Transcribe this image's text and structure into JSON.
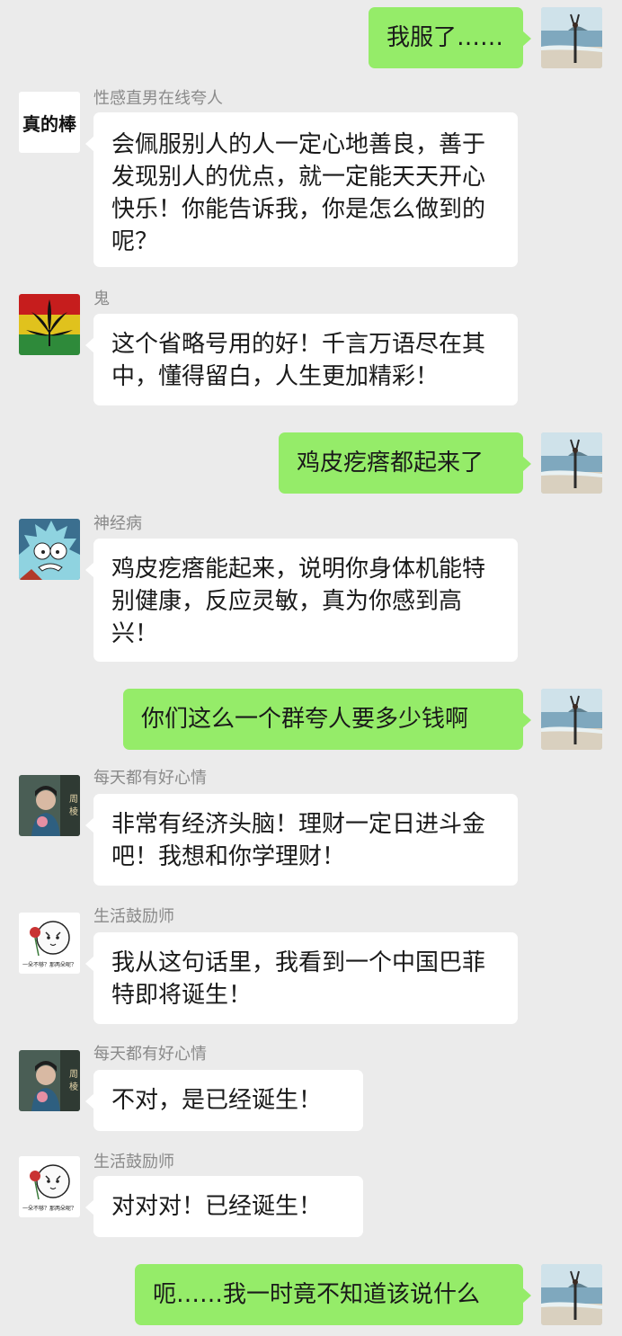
{
  "me": {
    "avatar_icon": "beach-photo-avatar"
  },
  "messages": [
    {
      "side": "right",
      "text": "我服了……"
    },
    {
      "side": "left",
      "name": "性感直男在线夸人",
      "avatar_text": "真的棒",
      "text": "会佩服别人的人一定心地善良，善于发现别人的优点，就一定能天天开心快乐！你能告诉我，你是怎么做到的呢？"
    },
    {
      "side": "left",
      "name": "鬼",
      "avatar_icon": "leaf-avatar",
      "text": "这个省略号用的好！千言万语尽在其中，懂得留白，人生更加精彩！"
    },
    {
      "side": "right",
      "text": "鸡皮疙瘩都起来了"
    },
    {
      "side": "left",
      "name": "神经病",
      "avatar_icon": "cartoon-face-avatar",
      "text": "鸡皮疙瘩能起来，说明你身体机能特别健康，反应灵敏，真为你感到高兴！"
    },
    {
      "side": "right",
      "text": "你们这么一个群夸人要多少钱啊"
    },
    {
      "side": "left",
      "name": "每天都有好心情",
      "avatar_icon": "person-photo-avatar",
      "text": "非常有经济头脑！理财一定日进斗金吧！我想和你学理财！"
    },
    {
      "side": "left",
      "name": "生活鼓励师",
      "avatar_icon": "sticker-face-avatar",
      "avatar_caption": "一朵不够？那两朵呢？",
      "text": "我从这句话里，我看到一个中国巴菲特即将诞生！"
    },
    {
      "side": "left",
      "name": "每天都有好心情",
      "avatar_icon": "person-photo-avatar",
      "text": "不对，是已经诞生！"
    },
    {
      "side": "left",
      "name": "生活鼓励师",
      "avatar_icon": "sticker-face-avatar",
      "avatar_caption": "一朵不够？那两朵呢？",
      "text": "对对对！已经诞生！"
    },
    {
      "side": "right",
      "text": "呃……我一时竟不知道该说什么"
    }
  ]
}
